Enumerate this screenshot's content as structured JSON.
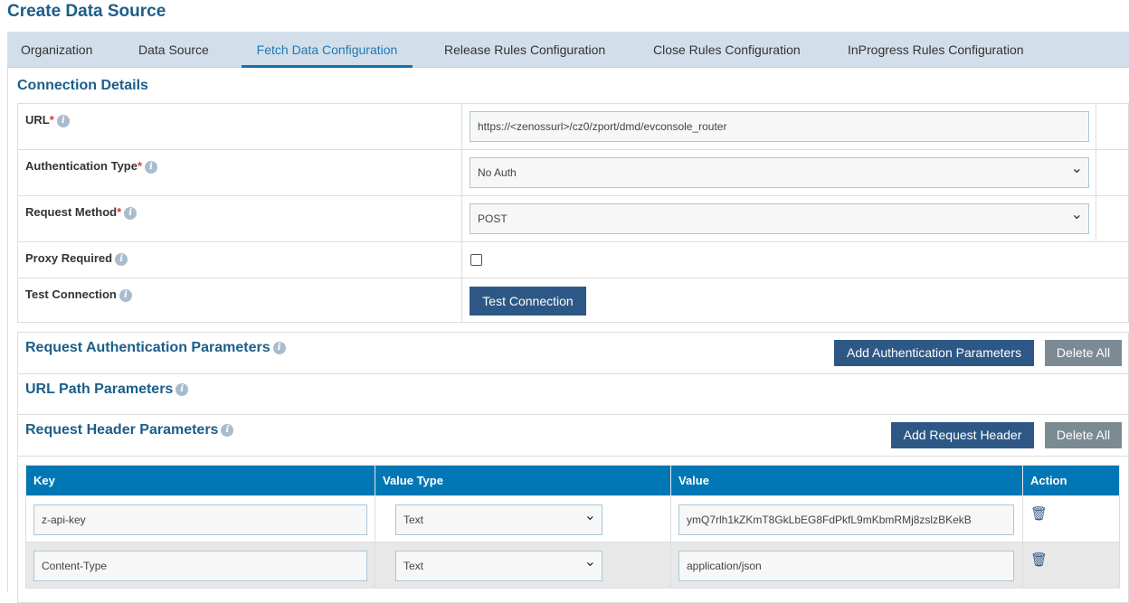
{
  "title": "Create Data Source",
  "tabs": [
    "Organization",
    "Data Source",
    "Fetch Data Configuration",
    "Release Rules Configuration",
    "Close Rules Configuration",
    "InProgress Rules Configuration"
  ],
  "connection": {
    "heading": "Connection Details",
    "url_label": "URL",
    "url_value": "https://<zenossurl>/cz0/zport/dmd/evconsole_router",
    "auth_label": "Authentication Type",
    "auth_value": "No Auth",
    "method_label": "Request Method",
    "method_value": "POST",
    "proxy_label": "Proxy Required",
    "test_label": "Test Connection",
    "test_button": "Test Connection",
    "required_mark": "*",
    "info_glyph": "i"
  },
  "params": {
    "auth_heading": "Request Authentication Parameters",
    "add_auth": "Add Authentication Parameters",
    "delete_all": "Delete All",
    "path_heading": "URL Path Parameters",
    "header_heading": "Request Header Parameters",
    "add_header": "Add Request Header"
  },
  "header_table": {
    "columns": [
      "Key",
      "Value Type",
      "Value",
      "Action"
    ],
    "rows": [
      {
        "key": "z-api-key",
        "type": "Text",
        "value": "ymQ7rlh1kZKmT8GkLbEG8FdPkfL9mKbmRMj8zslzBKekB"
      },
      {
        "key": "Content-Type",
        "type": "Text",
        "value": "application/json"
      }
    ]
  }
}
